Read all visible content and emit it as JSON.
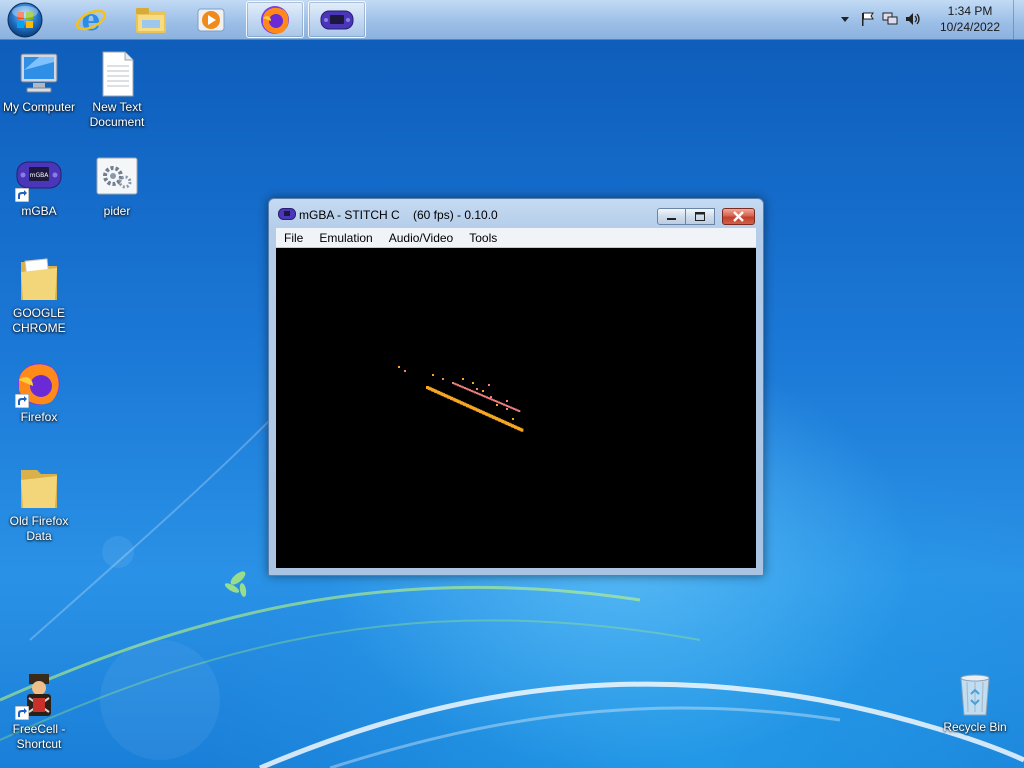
{
  "taskbar": {
    "clock_time": "1:34 PM",
    "clock_date": "10/24/2022",
    "pinned": [
      {
        "name": "internet-explorer",
        "icon": "ie-icon"
      },
      {
        "name": "file-explorer",
        "icon": "folder-icon"
      },
      {
        "name": "media-player",
        "icon": "media-player-icon"
      },
      {
        "name": "firefox",
        "icon": "firefox-icon",
        "active": true
      },
      {
        "name": "mgba",
        "icon": "gba-icon",
        "active": true
      }
    ]
  },
  "desktop_icons": [
    {
      "label_lines": [
        "My Computer"
      ],
      "icon": "computer-icon"
    },
    {
      "label_lines": [
        "New Text",
        "Document"
      ],
      "icon": "text-document-icon"
    },
    {
      "label_lines": [
        "mGBA"
      ],
      "icon": "gba-icon",
      "shortcut": true
    },
    {
      "label_lines": [
        "pider"
      ],
      "icon": "settings-file-icon"
    },
    {
      "label_lines": [
        "GOOGLE",
        "CHROME"
      ],
      "icon": "folder-icon"
    },
    {
      "label_lines": [
        "Firefox"
      ],
      "icon": "firefox-icon",
      "shortcut": true
    },
    {
      "label_lines": [
        "Old Firefox",
        "Data"
      ],
      "icon": "folder-icon"
    },
    {
      "label_lines": [
        "FreeCell -",
        "Shortcut"
      ],
      "icon": "freecell-icon",
      "shortcut": true
    },
    {
      "label_lines": [
        "Recycle Bin"
      ],
      "icon": "recycle-bin-icon"
    }
  ],
  "window": {
    "title": "mGBA - STITCH C    (60 fps) - 0.10.0",
    "menu": [
      "File",
      "Emulation",
      "Audio/Video",
      "Tools"
    ]
  },
  "colors": {
    "screen_bg": "#000000",
    "sprite_orange": "#f5a623",
    "sprite_pink": "#f08080"
  }
}
